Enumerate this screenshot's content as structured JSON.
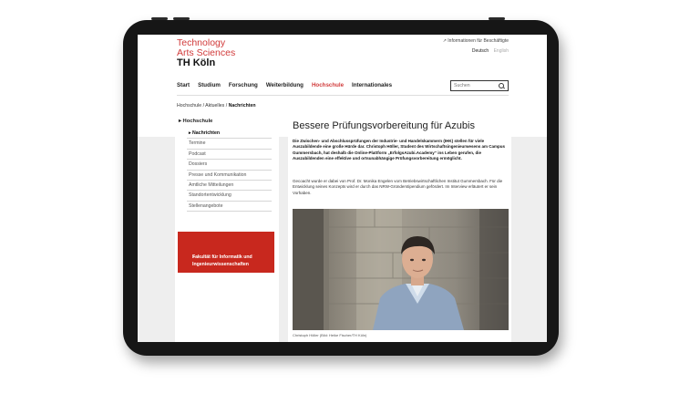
{
  "logo": {
    "line1": "Technology",
    "line2": "Arts Sciences",
    "line3": "TH Köln"
  },
  "header": {
    "info_link": "Informationen für Beschäftigte",
    "lang_de": "Deutsch",
    "lang_en": "English"
  },
  "nav": {
    "items": [
      {
        "label": "Start"
      },
      {
        "label": "Studium"
      },
      {
        "label": "Forschung"
      },
      {
        "label": "Weiterbildung"
      },
      {
        "label": "Hochschule"
      },
      {
        "label": "Internationales"
      }
    ],
    "active_index": 4
  },
  "search": {
    "placeholder": "Suchen"
  },
  "breadcrumb": {
    "items": [
      "Hochschule",
      "Aktuelles",
      "Nachrichten"
    ]
  },
  "sidebar": {
    "section": "Hochschule",
    "items": [
      {
        "label": "Nachrichten"
      },
      {
        "label": "Termine"
      },
      {
        "label": "Podcast"
      },
      {
        "label": "Dossiers"
      },
      {
        "label": "Presse und Kommunikation"
      },
      {
        "label": "Amtliche Mitteilungen"
      },
      {
        "label": "Standortentwicklung"
      },
      {
        "label": "Stellenangebote"
      }
    ],
    "active_index": 0,
    "promo": "Fakultät für Informatik und Ingenieurwissenschaften"
  },
  "article": {
    "title": "Bessere Prüfungsvorbereitung für Azubis",
    "lead": "Die Zwischen- und Abschlussprüfungen der Industrie- und Handelskammern (IHK) stellen für viele Auszubildende eine große Hürde dar. Christoph Höller, Student des Wirtschaftsingenieurwesens am Campus Gummersbach, hat deshalb die Online-Plattform „ErfolgsAzubi.Academy“ ins Leben gerufen, die Auszubildenden eine effektive und ortsunabhängige Prüfungsvorbereitung ermöglicht.",
    "body": "Gecoacht wurde er dabei von Prof. Dr. Monika Engelen vom Betriebswirtschaftlichen Institut Gummersbach. Für die Entwicklung seines Konzepts wird er durch das NRW-Gründerstipendium gefördert. Im Interview erläutert er sein Vorhaben.",
    "caption": "Christoph Höller (Bild: Heike Fischer/TH Köln)"
  },
  "colors": {
    "brand_red": "#d13a3a",
    "promo_red": "#c8281e",
    "frame": "#161616"
  }
}
